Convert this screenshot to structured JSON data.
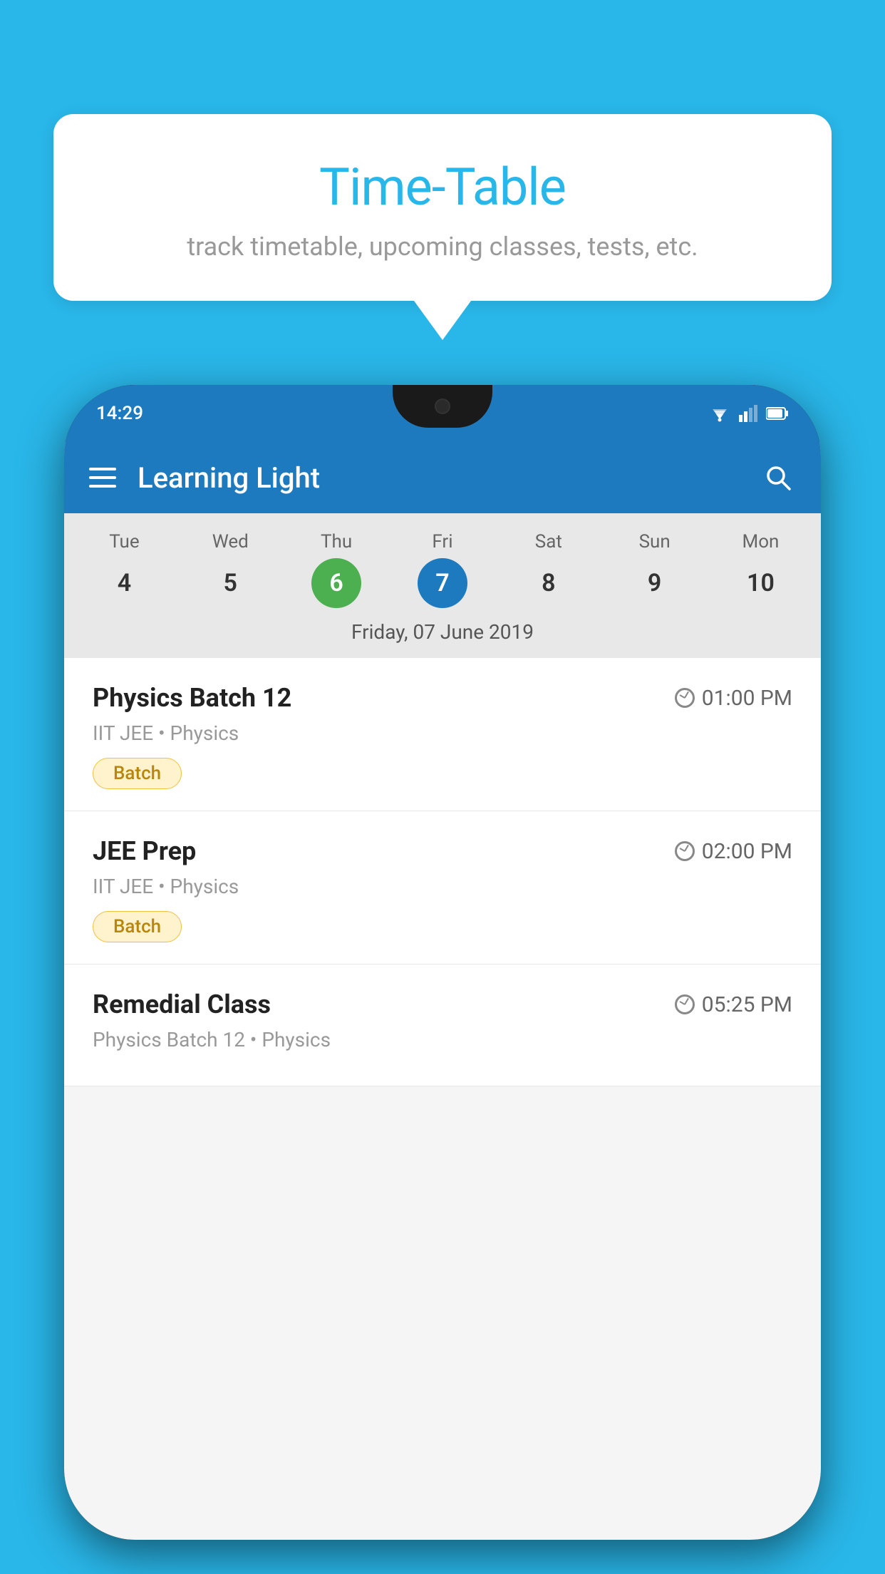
{
  "background_color": "#29b6e8",
  "speech_bubble": {
    "title": "Time-Table",
    "subtitle": "track timetable, upcoming classes, tests, etc."
  },
  "phone": {
    "status_bar": {
      "time": "14:29"
    },
    "app_bar": {
      "title": "Learning Light"
    },
    "calendar": {
      "days": [
        {
          "label": "Tue",
          "date": "4",
          "state": "normal"
        },
        {
          "label": "Wed",
          "date": "5",
          "state": "normal"
        },
        {
          "label": "Thu",
          "date": "6",
          "state": "today"
        },
        {
          "label": "Fri",
          "date": "7",
          "state": "selected"
        },
        {
          "label": "Sat",
          "date": "8",
          "state": "normal"
        },
        {
          "label": "Sun",
          "date": "9",
          "state": "normal"
        },
        {
          "label": "Mon",
          "date": "10",
          "state": "normal"
        }
      ],
      "selected_date_label": "Friday, 07 June 2019"
    },
    "schedule": [
      {
        "title": "Physics Batch 12",
        "time": "01:00 PM",
        "subtitle": "IIT JEE • Physics",
        "tag": "Batch"
      },
      {
        "title": "JEE Prep",
        "time": "02:00 PM",
        "subtitle": "IIT JEE • Physics",
        "tag": "Batch"
      },
      {
        "title": "Remedial Class",
        "time": "05:25 PM",
        "subtitle": "Physics Batch 12 • Physics",
        "tag": null
      }
    ]
  }
}
